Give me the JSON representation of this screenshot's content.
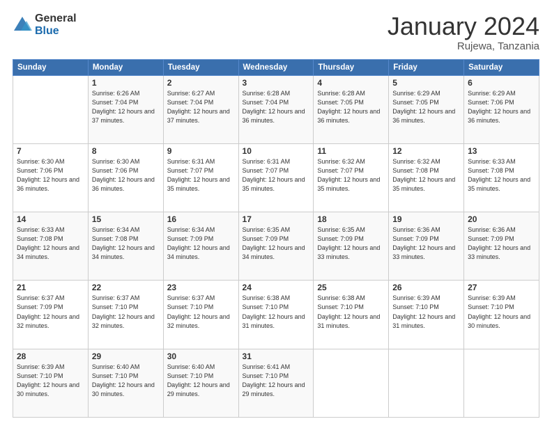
{
  "header": {
    "logo_general": "General",
    "logo_blue": "Blue",
    "month_title": "January 2024",
    "location": "Rujewa, Tanzania"
  },
  "calendar": {
    "days_of_week": [
      "Sunday",
      "Monday",
      "Tuesday",
      "Wednesday",
      "Thursday",
      "Friday",
      "Saturday"
    ],
    "weeks": [
      [
        {
          "day": "",
          "sunrise": "",
          "sunset": "",
          "daylight": ""
        },
        {
          "day": "1",
          "sunrise": "Sunrise: 6:26 AM",
          "sunset": "Sunset: 7:04 PM",
          "daylight": "Daylight: 12 hours and 37 minutes."
        },
        {
          "day": "2",
          "sunrise": "Sunrise: 6:27 AM",
          "sunset": "Sunset: 7:04 PM",
          "daylight": "Daylight: 12 hours and 37 minutes."
        },
        {
          "day": "3",
          "sunrise": "Sunrise: 6:28 AM",
          "sunset": "Sunset: 7:04 PM",
          "daylight": "Daylight: 12 hours and 36 minutes."
        },
        {
          "day": "4",
          "sunrise": "Sunrise: 6:28 AM",
          "sunset": "Sunset: 7:05 PM",
          "daylight": "Daylight: 12 hours and 36 minutes."
        },
        {
          "day": "5",
          "sunrise": "Sunrise: 6:29 AM",
          "sunset": "Sunset: 7:05 PM",
          "daylight": "Daylight: 12 hours and 36 minutes."
        },
        {
          "day": "6",
          "sunrise": "Sunrise: 6:29 AM",
          "sunset": "Sunset: 7:06 PM",
          "daylight": "Daylight: 12 hours and 36 minutes."
        }
      ],
      [
        {
          "day": "7",
          "sunrise": "Sunrise: 6:30 AM",
          "sunset": "Sunset: 7:06 PM",
          "daylight": "Daylight: 12 hours and 36 minutes."
        },
        {
          "day": "8",
          "sunrise": "Sunrise: 6:30 AM",
          "sunset": "Sunset: 7:06 PM",
          "daylight": "Daylight: 12 hours and 36 minutes."
        },
        {
          "day": "9",
          "sunrise": "Sunrise: 6:31 AM",
          "sunset": "Sunset: 7:07 PM",
          "daylight": "Daylight: 12 hours and 35 minutes."
        },
        {
          "day": "10",
          "sunrise": "Sunrise: 6:31 AM",
          "sunset": "Sunset: 7:07 PM",
          "daylight": "Daylight: 12 hours and 35 minutes."
        },
        {
          "day": "11",
          "sunrise": "Sunrise: 6:32 AM",
          "sunset": "Sunset: 7:07 PM",
          "daylight": "Daylight: 12 hours and 35 minutes."
        },
        {
          "day": "12",
          "sunrise": "Sunrise: 6:32 AM",
          "sunset": "Sunset: 7:08 PM",
          "daylight": "Daylight: 12 hours and 35 minutes."
        },
        {
          "day": "13",
          "sunrise": "Sunrise: 6:33 AM",
          "sunset": "Sunset: 7:08 PM",
          "daylight": "Daylight: 12 hours and 35 minutes."
        }
      ],
      [
        {
          "day": "14",
          "sunrise": "Sunrise: 6:33 AM",
          "sunset": "Sunset: 7:08 PM",
          "daylight": "Daylight: 12 hours and 34 minutes."
        },
        {
          "day": "15",
          "sunrise": "Sunrise: 6:34 AM",
          "sunset": "Sunset: 7:08 PM",
          "daylight": "Daylight: 12 hours and 34 minutes."
        },
        {
          "day": "16",
          "sunrise": "Sunrise: 6:34 AM",
          "sunset": "Sunset: 7:09 PM",
          "daylight": "Daylight: 12 hours and 34 minutes."
        },
        {
          "day": "17",
          "sunrise": "Sunrise: 6:35 AM",
          "sunset": "Sunset: 7:09 PM",
          "daylight": "Daylight: 12 hours and 34 minutes."
        },
        {
          "day": "18",
          "sunrise": "Sunrise: 6:35 AM",
          "sunset": "Sunset: 7:09 PM",
          "daylight": "Daylight: 12 hours and 33 minutes."
        },
        {
          "day": "19",
          "sunrise": "Sunrise: 6:36 AM",
          "sunset": "Sunset: 7:09 PM",
          "daylight": "Daylight: 12 hours and 33 minutes."
        },
        {
          "day": "20",
          "sunrise": "Sunrise: 6:36 AM",
          "sunset": "Sunset: 7:09 PM",
          "daylight": "Daylight: 12 hours and 33 minutes."
        }
      ],
      [
        {
          "day": "21",
          "sunrise": "Sunrise: 6:37 AM",
          "sunset": "Sunset: 7:09 PM",
          "daylight": "Daylight: 12 hours and 32 minutes."
        },
        {
          "day": "22",
          "sunrise": "Sunrise: 6:37 AM",
          "sunset": "Sunset: 7:10 PM",
          "daylight": "Daylight: 12 hours and 32 minutes."
        },
        {
          "day": "23",
          "sunrise": "Sunrise: 6:37 AM",
          "sunset": "Sunset: 7:10 PM",
          "daylight": "Daylight: 12 hours and 32 minutes."
        },
        {
          "day": "24",
          "sunrise": "Sunrise: 6:38 AM",
          "sunset": "Sunset: 7:10 PM",
          "daylight": "Daylight: 12 hours and 31 minutes."
        },
        {
          "day": "25",
          "sunrise": "Sunrise: 6:38 AM",
          "sunset": "Sunset: 7:10 PM",
          "daylight": "Daylight: 12 hours and 31 minutes."
        },
        {
          "day": "26",
          "sunrise": "Sunrise: 6:39 AM",
          "sunset": "Sunset: 7:10 PM",
          "daylight": "Daylight: 12 hours and 31 minutes."
        },
        {
          "day": "27",
          "sunrise": "Sunrise: 6:39 AM",
          "sunset": "Sunset: 7:10 PM",
          "daylight": "Daylight: 12 hours and 30 minutes."
        }
      ],
      [
        {
          "day": "28",
          "sunrise": "Sunrise: 6:39 AM",
          "sunset": "Sunset: 7:10 PM",
          "daylight": "Daylight: 12 hours and 30 minutes."
        },
        {
          "day": "29",
          "sunrise": "Sunrise: 6:40 AM",
          "sunset": "Sunset: 7:10 PM",
          "daylight": "Daylight: 12 hours and 30 minutes."
        },
        {
          "day": "30",
          "sunrise": "Sunrise: 6:40 AM",
          "sunset": "Sunset: 7:10 PM",
          "daylight": "Daylight: 12 hours and 29 minutes."
        },
        {
          "day": "31",
          "sunrise": "Sunrise: 6:41 AM",
          "sunset": "Sunset: 7:10 PM",
          "daylight": "Daylight: 12 hours and 29 minutes."
        },
        {
          "day": "",
          "sunrise": "",
          "sunset": "",
          "daylight": ""
        },
        {
          "day": "",
          "sunrise": "",
          "sunset": "",
          "daylight": ""
        },
        {
          "day": "",
          "sunrise": "",
          "sunset": "",
          "daylight": ""
        }
      ]
    ]
  }
}
